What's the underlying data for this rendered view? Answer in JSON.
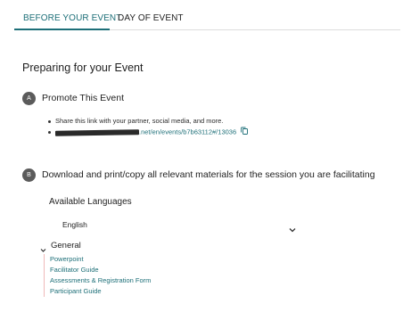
{
  "tabs": [
    {
      "label": "BEFORE YOUR EVENT",
      "active": true
    },
    {
      "label": "DAY OF EVENT",
      "active": false
    }
  ],
  "page_title": "Preparing for your Event",
  "steps": [
    {
      "badge": "A",
      "title": "Promote This Event",
      "bullets": {
        "share_text": "Share this link with your partner, social media, and more.",
        "link_visible": ".net/en/events/b7b63112#/13036"
      }
    },
    {
      "badge": "B",
      "title": "Download and print/copy all relevant materials for the session you are facilitating",
      "languages_label": "Available Languages",
      "language_selected": "English",
      "section_label": "General",
      "materials": [
        "Powerpoint",
        "Facilitator Guide",
        "Assessments & Registration Form",
        "Participant Guide"
      ]
    }
  ],
  "icons": {
    "copy": "copy-icon",
    "dropdown": "chevron-down-icon",
    "collapse": "chevron-down-icon"
  },
  "colors": {
    "accent": "#1d6f78",
    "badge": "#5b5b5b",
    "materials_rule": "#f0b9b9"
  }
}
